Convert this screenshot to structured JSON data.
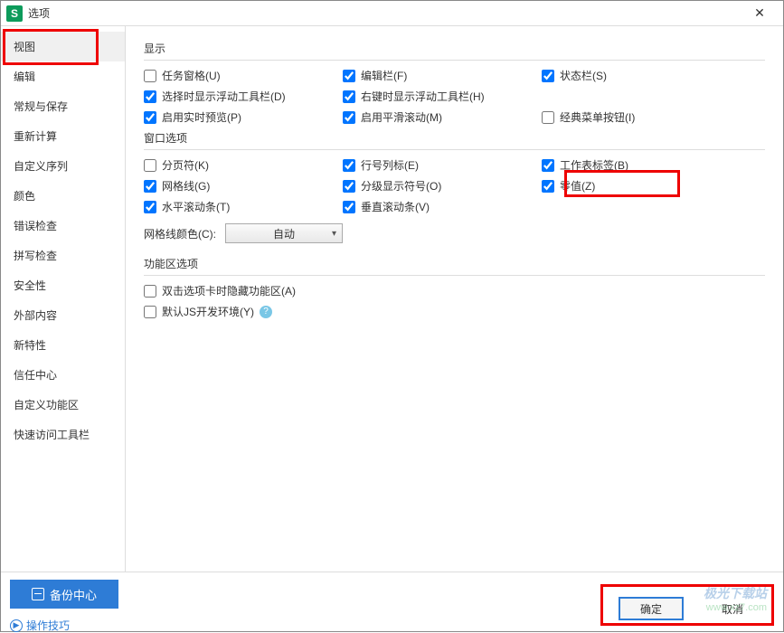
{
  "title": "选项",
  "app_icon": "S",
  "sidebar": {
    "items": [
      {
        "label": "视图",
        "active": true
      },
      {
        "label": "编辑"
      },
      {
        "label": "常规与保存"
      },
      {
        "label": "重新计算"
      },
      {
        "label": "自定义序列"
      },
      {
        "label": "颜色"
      },
      {
        "label": "错误检查"
      },
      {
        "label": "拼写检查"
      },
      {
        "label": "安全性"
      },
      {
        "label": "外部内容"
      },
      {
        "label": "新特性"
      },
      {
        "label": "信任中心"
      },
      {
        "label": "自定义功能区"
      },
      {
        "label": "快速访问工具栏"
      }
    ]
  },
  "sections": {
    "display": {
      "title": "显示",
      "opts": [
        {
          "label": "任务窗格(U)",
          "checked": false
        },
        {
          "label": "编辑栏(F)",
          "checked": true
        },
        {
          "label": "状态栏(S)",
          "checked": true
        },
        {
          "label": "选择时显示浮动工具栏(D)",
          "checked": true
        },
        {
          "label": "右键时显示浮动工具栏(H)",
          "checked": true
        },
        {
          "label": "",
          "checked": null
        },
        {
          "label": "启用实时预览(P)",
          "checked": true
        },
        {
          "label": "启用平滑滚动(M)",
          "checked": true
        },
        {
          "label": "经典菜单按钮(I)",
          "checked": false
        }
      ]
    },
    "window": {
      "title": "窗口选项",
      "opts": [
        {
          "label": "分页符(K)",
          "checked": false
        },
        {
          "label": "行号列标(E)",
          "checked": true
        },
        {
          "label": "工作表标签(B)",
          "checked": true
        },
        {
          "label": "网格线(G)",
          "checked": true
        },
        {
          "label": "分级显示符号(O)",
          "checked": true
        },
        {
          "label": "零值(Z)",
          "checked": true
        },
        {
          "label": "水平滚动条(T)",
          "checked": true
        },
        {
          "label": "垂直滚动条(V)",
          "checked": true
        }
      ],
      "gridline_label": "网格线颜色(C):",
      "gridline_value": "自动"
    },
    "ribbon": {
      "title": "功能区选项",
      "opts": [
        {
          "label": "双击选项卡时隐藏功能区(A)",
          "checked": false
        },
        {
          "label": "默认JS开发环境(Y)",
          "checked": false,
          "help": true
        }
      ]
    }
  },
  "footer": {
    "backup": "备份中心",
    "tips": "操作技巧",
    "ok": "确定",
    "cancel": "取消"
  },
  "watermark": {
    "line1": "极光下载站",
    "line2": "www.xz7.com"
  }
}
